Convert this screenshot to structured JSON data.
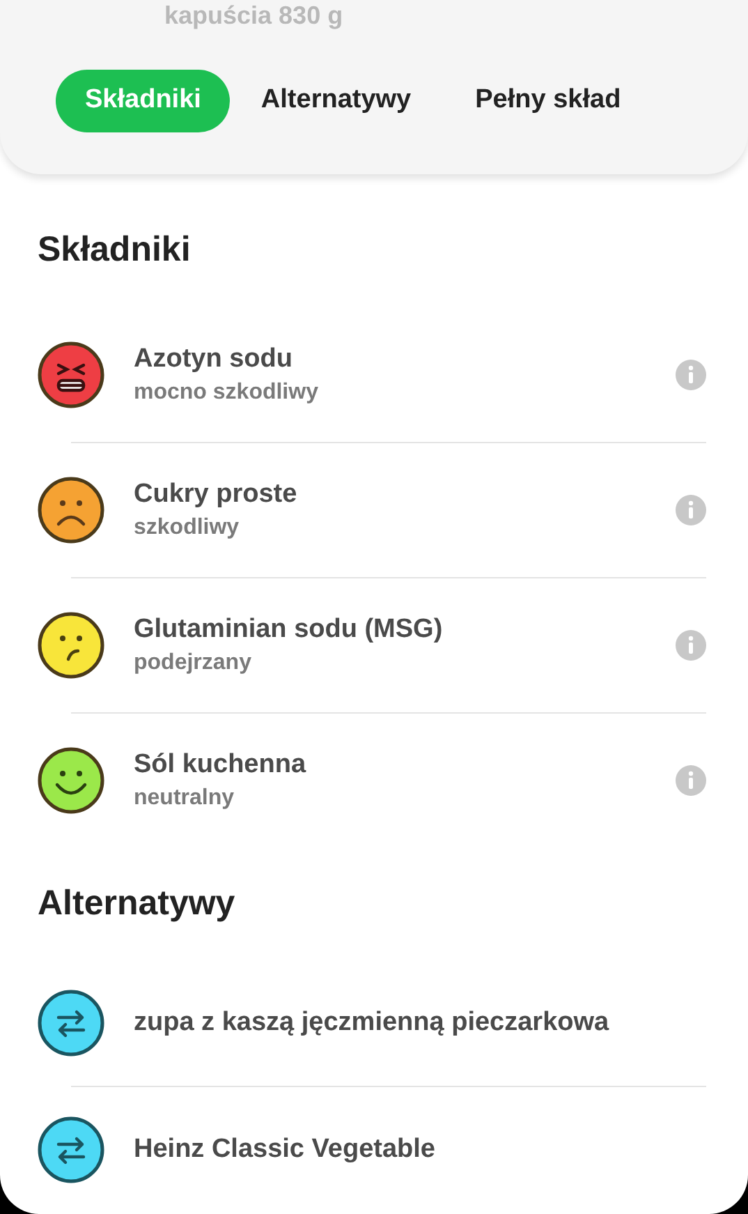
{
  "header": {
    "subtitle": "kapuścia 830 g"
  },
  "tabs": [
    {
      "label": "Składniki",
      "selected": true
    },
    {
      "label": "Alternatywy",
      "selected": false
    },
    {
      "label": "Pełny skład",
      "selected": false
    }
  ],
  "ingredients": {
    "title": "Składniki",
    "items": [
      {
        "name": "Azotyn sodu",
        "rating": "mocno szkodliwy",
        "kind": "angry",
        "color": "#ee3e44"
      },
      {
        "name": "Cukry proste",
        "rating": "szkodliwy",
        "kind": "sad",
        "color": "#f5a233"
      },
      {
        "name": "Glutaminian sodu (MSG)",
        "rating": "podejrzany",
        "kind": "unsure",
        "color": "#f8e53a"
      },
      {
        "name": "Sól kuchenna",
        "rating": "neutralny",
        "kind": "happy",
        "color": "#9be84a"
      }
    ]
  },
  "alternatives": {
    "title": "Alternatywy",
    "items": [
      {
        "name": "zupa z kaszą jęczmienną pieczarkowa"
      },
      {
        "name": "Heinz Classic Vegetable"
      }
    ]
  }
}
